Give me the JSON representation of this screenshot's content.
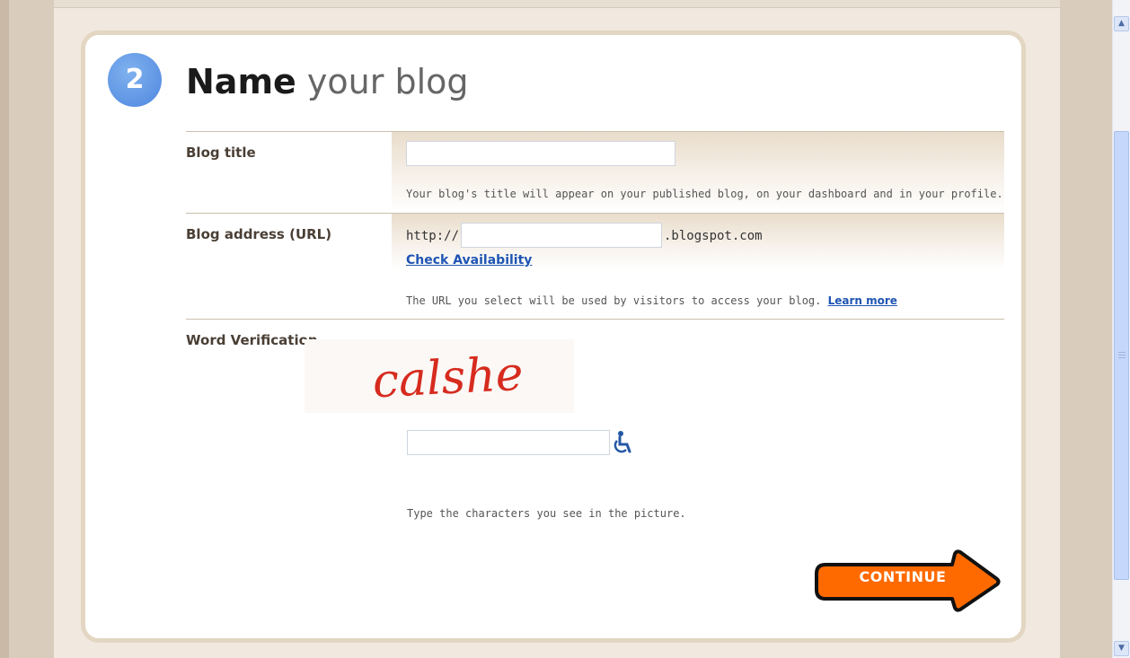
{
  "step": {
    "number": "2",
    "title_bold": "Name",
    "title_rest": "your blog"
  },
  "blog_title": {
    "label": "Blog title",
    "value": "",
    "hint": "Your blog's title will appear on your published blog, on your dashboard and in your profile."
  },
  "blog_address": {
    "label": "Blog address (URL)",
    "prefix": "http://",
    "value": "",
    "suffix": ".blogspot.com",
    "check_link": "Check Availability",
    "hint": "The URL you select will be used by visitors to access your blog.",
    "learn_more": "Learn more"
  },
  "word_verification": {
    "label": "Word Verification",
    "captcha_text": "calshe",
    "value": "",
    "hint": "Type the characters you see in the picture.",
    "accessibility_icon": "wheelchair-icon"
  },
  "continue_button": {
    "label": "CONTINUE",
    "color": "#ff6a00"
  },
  "colors": {
    "accent_blue": "#4f86e0",
    "link": "#1f55b3"
  }
}
